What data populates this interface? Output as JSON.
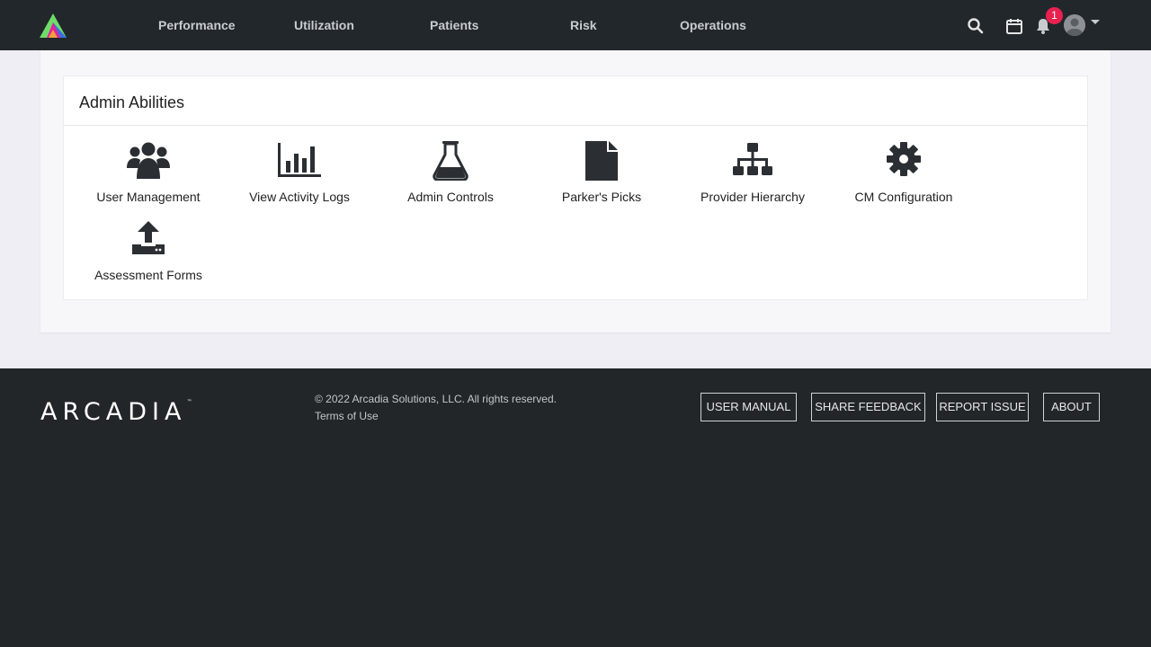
{
  "nav": {
    "items": [
      "Performance",
      "Utilization",
      "Patients",
      "Risk",
      "Operations"
    ],
    "notification_count": "1",
    "icons": [
      "search-icon",
      "calendar-icon",
      "bell-icon",
      "user-avatar-icon"
    ]
  },
  "main": {
    "card_title": "Admin Abilities",
    "tiles": [
      {
        "label": "User Management",
        "icon": "users-icon"
      },
      {
        "label": "View Activity Logs",
        "icon": "bar-chart-icon"
      },
      {
        "label": "Admin Controls",
        "icon": "flask-icon"
      },
      {
        "label": "Parker's Picks",
        "icon": "document-icon"
      },
      {
        "label": "Provider Hierarchy",
        "icon": "sitemap-icon"
      },
      {
        "label": "CM Configuration",
        "icon": "gear-icon"
      },
      {
        "label": "Assessment Forms",
        "icon": "upload-icon"
      }
    ]
  },
  "footer": {
    "brand": "ARCADIA",
    "trademark": "™",
    "copyright": "© 2022 Arcadia Solutions, LLC. All rights reserved.",
    "terms": "Terms of Use",
    "buttons": [
      "USER MANUAL",
      "SHARE FEEDBACK",
      "REPORT ISSUE",
      "ABOUT"
    ]
  },
  "colors": {
    "nav_bg": "#22272b",
    "badge": "#e8214f",
    "page_bg": "#eeeef4",
    "footer_bg": "#222629"
  }
}
